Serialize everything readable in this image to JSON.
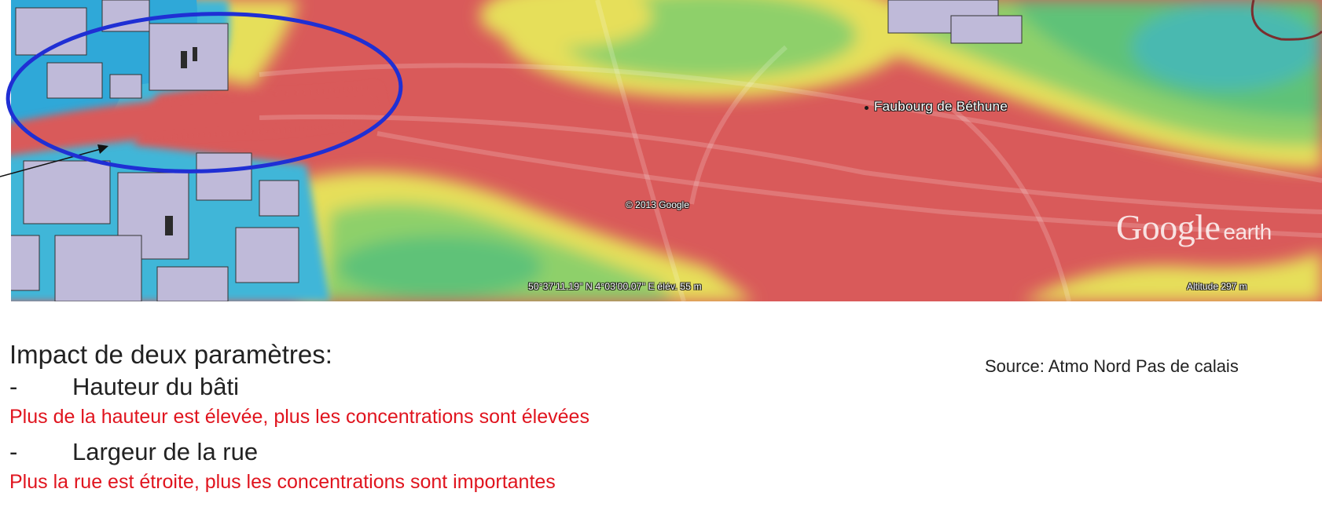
{
  "map": {
    "place_label": "Faubourg de Béthune",
    "copyright": "© 2013 Google",
    "coordinates": "50°37'11.19\" N  4°03'00.07\" E élév.  55 m",
    "altitude": "Altitude  297 m",
    "brand": {
      "main": "Google",
      "sub": "earth"
    },
    "colors": {
      "high_concentration": "#d95a5a",
      "medium_concentration": "#e9e35a",
      "low_concentration": "#69c86c",
      "very_low_concentration": "#3fb6d8",
      "buildings": "#bfbad9",
      "highlight_ellipse": "#1f2fd4"
    }
  },
  "text": {
    "heading": "Impact de deux paramètres:",
    "param1": {
      "dash": "-",
      "label": "Hauteur du bâti",
      "note": "Plus de la hauteur est élevée, plus les concentrations sont élevées"
    },
    "param2": {
      "dash": "-",
      "label": "Largeur de la rue",
      "note": "Plus la rue est étroite, plus les concentrations sont importantes"
    },
    "source": "Source: Atmo Nord Pas de calais"
  }
}
